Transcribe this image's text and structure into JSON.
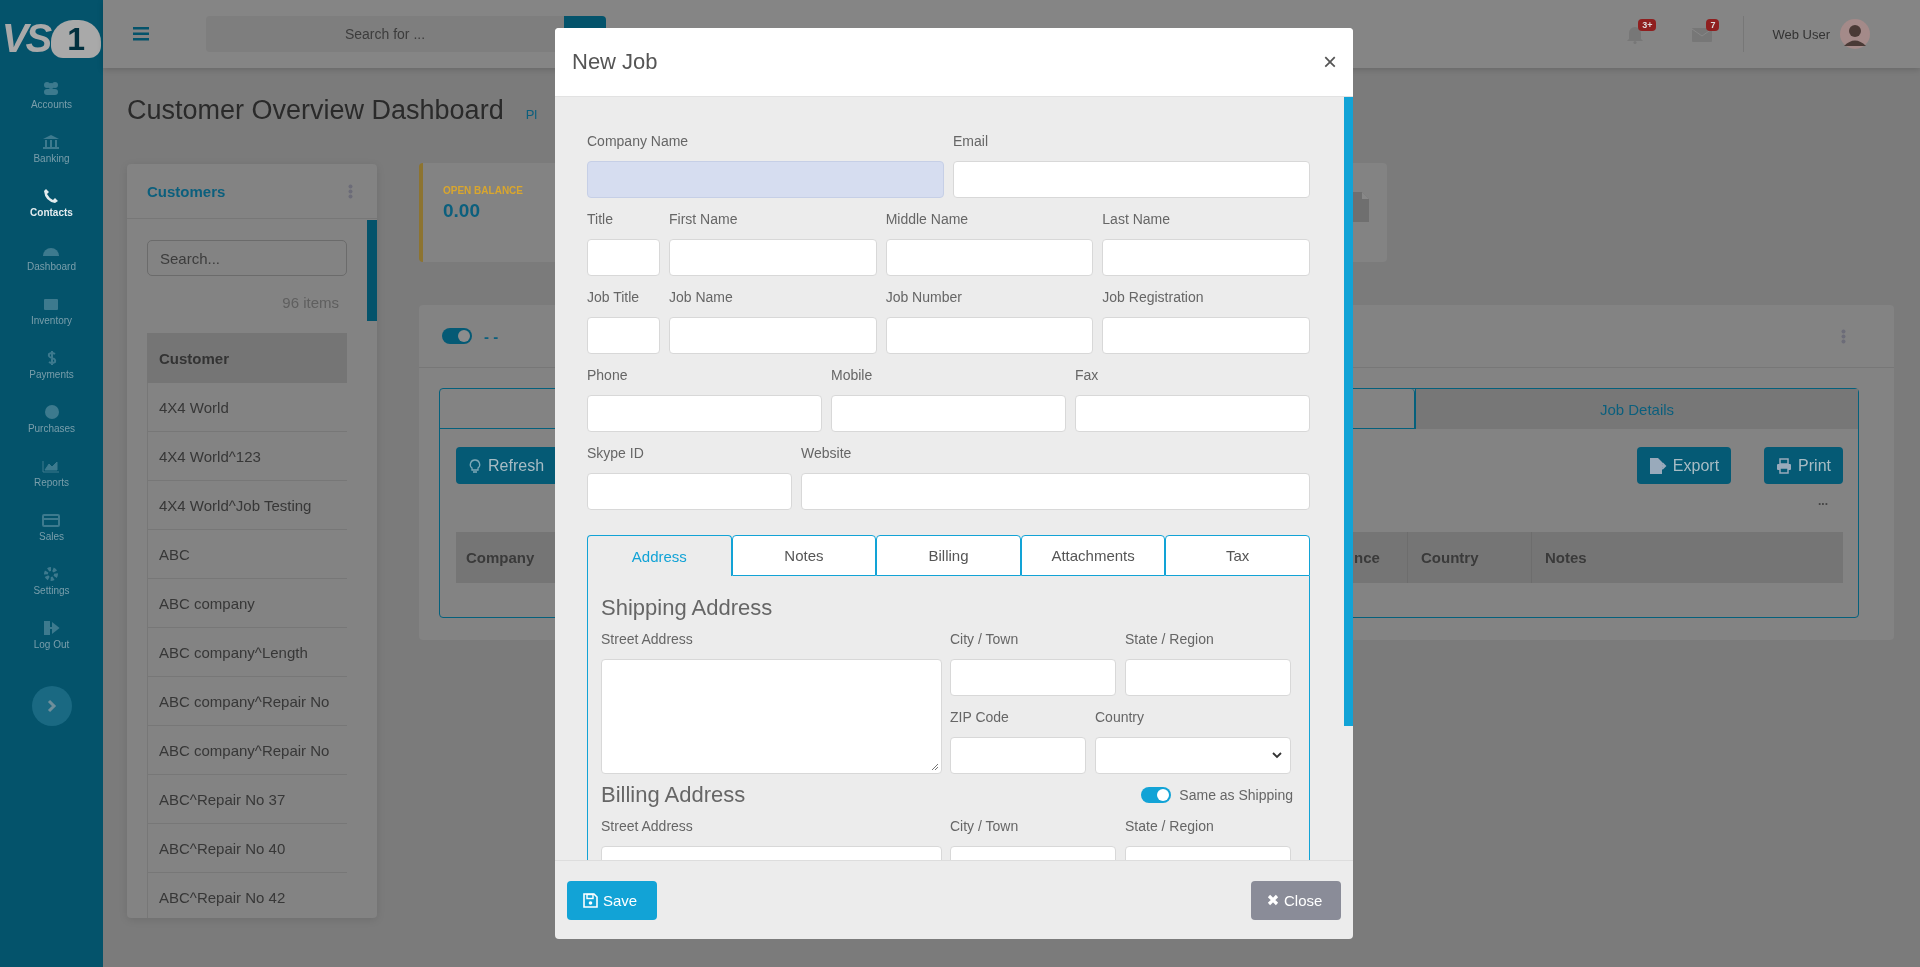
{
  "sidebar": {
    "logo": "VS",
    "logo_mark": "1",
    "items": [
      {
        "label": "Accounts",
        "selected": false
      },
      {
        "label": "Banking",
        "selected": false
      },
      {
        "label": "Contacts",
        "selected": true
      },
      {
        "label": "Dashboard",
        "selected": false
      },
      {
        "label": "Inventory",
        "selected": false
      },
      {
        "label": "Payments",
        "selected": false
      },
      {
        "label": "Purchases",
        "selected": false
      },
      {
        "label": "Reports",
        "selected": false
      },
      {
        "label": "Sales",
        "selected": false
      },
      {
        "label": "Settings",
        "selected": false
      },
      {
        "label": "Log Out",
        "selected": false
      }
    ]
  },
  "header": {
    "search_placeholder": "Search for ...",
    "notifications": "3+",
    "messages": "7",
    "user": "Web User"
  },
  "page": {
    "title": "Customer Overview Dashboard",
    "title_link": "Pl"
  },
  "customers": {
    "title": "Customers",
    "search_placeholder": "Search...",
    "count": "96 items",
    "column": "Customer",
    "rows": [
      "4X4 World",
      "4X4 World^123",
      "4X4 World^Job Testing",
      "ABC",
      "ABC company",
      "ABC company^Length",
      "ABC company^Repair No",
      "ABC company^Repair No",
      "ABC^Repair No 37",
      "ABC^Repair No 40",
      "ABC^Repair No 42"
    ]
  },
  "balance_card": {
    "label": "OPEN BALANCE",
    "value": "0.00"
  },
  "jobs_panel": {
    "toggle_on": true,
    "toggle_label": "- -",
    "tabs": [
      {
        "selected": false
      },
      {
        "label": "Job Details",
        "selected": true
      }
    ],
    "refresh": "Refresh",
    "export": "Export",
    "print": "Print",
    "more": "...",
    "columns": [
      "Company",
      "nce",
      "Country",
      "Notes"
    ]
  },
  "modal": {
    "title": "New Job",
    "close_glyph": "×",
    "rows": [
      [
        {
          "label": "Company Name",
          "disabled": true
        },
        {
          "label": "Email",
          "disabled": false
        }
      ],
      [
        {
          "label": "Title",
          "disabled": false
        },
        {
          "label": "First Name",
          "disabled": false
        },
        {
          "label": "Middle Name",
          "disabled": false
        },
        {
          "label": "Last Name",
          "disabled": false
        }
      ],
      [
        {
          "label": "Job Title",
          "disabled": false
        },
        {
          "label": "Job Name",
          "disabled": false
        },
        {
          "label": "Job Number",
          "disabled": false
        },
        {
          "label": "Job Registration",
          "disabled": false
        }
      ],
      [
        {
          "label": "Phone",
          "disabled": false
        },
        {
          "label": "Mobile",
          "disabled": false
        },
        {
          "label": "Fax",
          "disabled": false
        }
      ],
      [
        {
          "label": "Skype ID",
          "disabled": false
        },
        {
          "label": "Website",
          "disabled": false
        }
      ]
    ],
    "tabs": [
      {
        "label": "Address",
        "selected": true
      },
      {
        "label": "Notes",
        "selected": false
      },
      {
        "label": "Billing",
        "selected": false
      },
      {
        "label": "Attachments",
        "selected": false
      },
      {
        "label": "Tax",
        "selected": false
      }
    ],
    "shipping": {
      "heading": "Shipping Address",
      "street": "Street Address",
      "city": "City / Town",
      "state": "State / Region",
      "zip": "ZIP Code",
      "country": "Country"
    },
    "billing": {
      "heading": "Billing Address",
      "same_as_shipping": true,
      "same_label": "Same as Shipping",
      "street": "Street Address",
      "city": "City / Town",
      "state": "State / Region"
    },
    "save": "Save",
    "close": "Close"
  }
}
